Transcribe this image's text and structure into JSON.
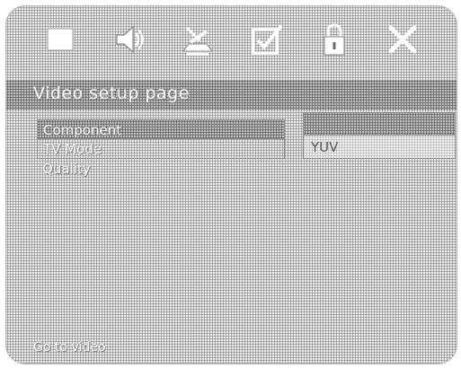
{
  "toolbar": {
    "icons": [
      {
        "name": "general-setup-icon"
      },
      {
        "name": "audio-setup-icon"
      },
      {
        "name": "video-setup-icon"
      },
      {
        "name": "preference-setup-icon"
      },
      {
        "name": "password-setup-icon"
      },
      {
        "name": "exit-setup-icon"
      }
    ]
  },
  "page": {
    "title": "Video setup page"
  },
  "menu": {
    "items": [
      {
        "label": "Component"
      },
      {
        "label": "TV Mode"
      },
      {
        "label": "Quality"
      }
    ]
  },
  "submenu": {
    "selected": "",
    "option": "YUV"
  },
  "footer": {
    "text": "Go to video"
  }
}
